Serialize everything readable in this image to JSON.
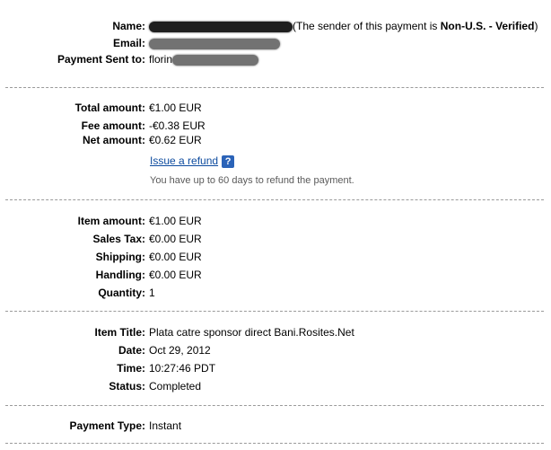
{
  "sender": {
    "name_label": "Name:",
    "email_label": "Email:",
    "payment_sent_to_label": "Payment Sent to:",
    "sender_note_prefix": "(The sender of this payment is ",
    "sender_note_status": "Non-U.S. - Verified",
    "sender_note_suffix": ")",
    "payment_sent_to_visible": "florin"
  },
  "amounts": {
    "total_label": "Total amount:",
    "total_value": "€1.00 EUR",
    "fee_label": "Fee amount:",
    "fee_value": "-€0.38 EUR",
    "net_label": "Net amount:",
    "net_value": "€0.62 EUR",
    "refund_link": "Issue a refund",
    "help_icon_text": "?",
    "refund_note": "You have up to 60 days to refund the payment."
  },
  "item_costs": {
    "item_amount_label": "Item amount:",
    "item_amount_value": "€1.00 EUR",
    "sales_tax_label": "Sales Tax:",
    "sales_tax_value": "€0.00 EUR",
    "shipping_label": "Shipping:",
    "shipping_value": "€0.00 EUR",
    "handling_label": "Handling:",
    "handling_value": "€0.00 EUR",
    "quantity_label": "Quantity:",
    "quantity_value": "1"
  },
  "item_details": {
    "title_label": "Item Title:",
    "title_value": "Plata catre sponsor direct Bani.Rosites.Net",
    "date_label": "Date:",
    "date_value": "Oct 29, 2012",
    "time_label": "Time:",
    "time_value": "10:27:46 PDT",
    "status_label": "Status:",
    "status_value": "Completed"
  },
  "payment": {
    "type_label": "Payment Type:",
    "type_value": "Instant"
  }
}
